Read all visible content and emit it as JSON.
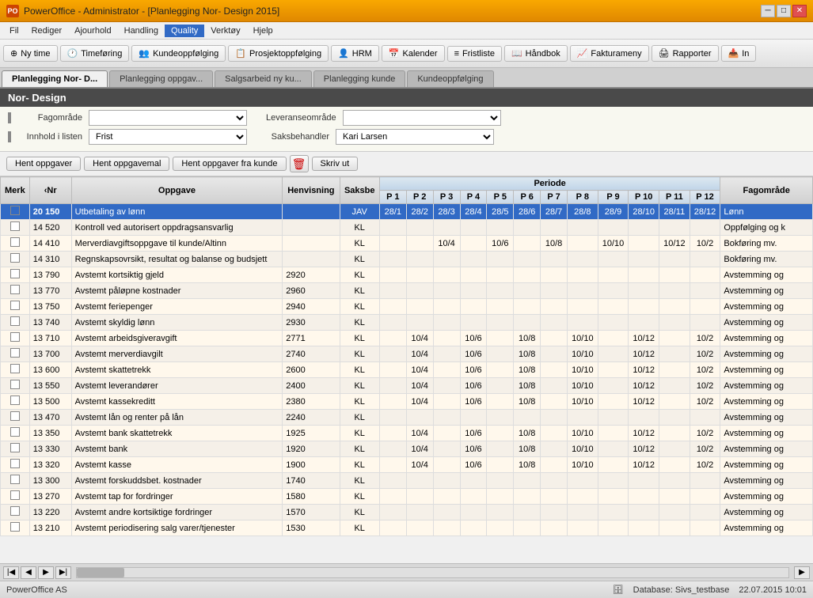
{
  "titlebar": {
    "title": "PowerOffice - Administrator - [Planlegging Nor- Design 2015]",
    "icon": "PO",
    "controls": [
      "minimize",
      "restore",
      "close"
    ]
  },
  "menu": {
    "items": [
      "Fil",
      "Rediger",
      "Ajourhold",
      "Handling",
      "Quality",
      "Verktøy",
      "Hjelp"
    ]
  },
  "toolbar": {
    "items": [
      {
        "label": "Ny time",
        "icon": "⊕"
      },
      {
        "label": "Timeføring",
        "icon": "🕐"
      },
      {
        "label": "Kundeoppfølging",
        "icon": "👥"
      },
      {
        "label": "Prosjektoppfølging",
        "icon": "📋"
      },
      {
        "label": "HRM",
        "icon": "👤"
      },
      {
        "label": "Kalender",
        "icon": "📅"
      },
      {
        "label": "Fristliste",
        "icon": "≡"
      },
      {
        "label": "Håndbok",
        "icon": "📖"
      },
      {
        "label": "Fakturameny",
        "icon": "📈"
      },
      {
        "label": "Rapporter",
        "icon": "🖨"
      },
      {
        "label": "In",
        "icon": "📥"
      }
    ]
  },
  "tabs": [
    {
      "label": "Planlegging Nor- D...",
      "active": true
    },
    {
      "label": "Planlegging oppgav...",
      "active": false
    },
    {
      "label": "Salgsarbeid ny ku...",
      "active": false
    },
    {
      "label": "Planlegging kunde",
      "active": false
    },
    {
      "label": "Kundeoppfølging",
      "active": false
    }
  ],
  "section": {
    "title": "Nor- Design"
  },
  "filters": {
    "fagomrade_label": "Fagområde",
    "fagomrade_value": "",
    "leveranseomrade_label": "Leveranseområde",
    "leveranseomrade_value": "",
    "innhold_label": "Innhold i listen",
    "innhold_value": "Frist",
    "saksbehandler_label": "Saksbehandler",
    "saksbehandler_value": "Kari Larsen"
  },
  "action_buttons": [
    {
      "label": "Hent oppgaver"
    },
    {
      "label": "Hent oppgavemal"
    },
    {
      "label": "Hent oppgaver fra kunde"
    },
    {
      "label": "🗑",
      "type": "delete"
    },
    {
      "label": "Skriv ut"
    }
  ],
  "table": {
    "header_row1": {
      "merk": "Merk",
      "nr": "‹Nr",
      "oppgave": "Oppgave",
      "henvisning": "Henvisning",
      "saksbe": "Saksbe",
      "periode": "Periode",
      "fagomrade": "Fagområde"
    },
    "header_row2": {
      "p1": "P 1",
      "p2": "P 2",
      "p3": "P 3",
      "p4": "P 4",
      "p5": "P 5",
      "p6": "P 6",
      "p7": "P 7",
      "p8": "P 8",
      "p9": "P 9",
      "p10": "P 10",
      "p11": "P 11",
      "p12": "P 12"
    },
    "rows": [
      {
        "checked": true,
        "nr": "20 150",
        "oppgave": "Utbetaling av lønn",
        "henvisning": "",
        "saksbe": "JAV",
        "p1": "28/1",
        "p2": "28/2",
        "p3": "28/3",
        "p4": "28/4",
        "p5": "28/5",
        "p6": "28/6",
        "p7": "28/7",
        "p8": "28/8",
        "p9": "28/9",
        "p10": "28/10",
        "p11": "28/11",
        "p12": "28/12",
        "fagomrade": "Lønn",
        "selected": true
      },
      {
        "checked": false,
        "nr": "14 520",
        "oppgave": "Kontroll ved autorisert oppdragsansvarlig",
        "henvisning": "",
        "saksbe": "KL",
        "p1": "",
        "p2": "",
        "p3": "",
        "p4": "",
        "p5": "",
        "p6": "",
        "p7": "",
        "p8": "",
        "p9": "",
        "p10": "",
        "p11": "",
        "p12": "",
        "fagomrade": "Oppfølging og k",
        "selected": false
      },
      {
        "checked": false,
        "nr": "14 410",
        "oppgave": "Merverdiavgiftsoppgave til kunde/Altinn",
        "henvisning": "",
        "saksbe": "KL",
        "p1": "",
        "p2": "",
        "p3": "10/4",
        "p4": "",
        "p5": "10/6",
        "p6": "",
        "p7": "10/8",
        "p8": "",
        "p9": "10/10",
        "p10": "",
        "p11": "10/12",
        "p12": "10/2",
        "fagomrade": "Bokføring mv.",
        "selected": false
      },
      {
        "checked": false,
        "nr": "14 310",
        "oppgave": "Regnskapsovrsikt, resultat og balanse og budsjett",
        "henvisning": "",
        "saksbe": "KL",
        "p1": "",
        "p2": "",
        "p3": "",
        "p4": "",
        "p5": "",
        "p6": "",
        "p7": "",
        "p8": "",
        "p9": "",
        "p10": "",
        "p11": "",
        "p12": "",
        "fagomrade": "Bokføring mv.",
        "selected": false
      },
      {
        "checked": false,
        "nr": "13 790",
        "oppgave": "Avstemt kortsiktig gjeld",
        "henvisning": "2920",
        "saksbe": "KL",
        "p1": "",
        "p2": "",
        "p3": "",
        "p4": "",
        "p5": "",
        "p6": "",
        "p7": "",
        "p8": "",
        "p9": "",
        "p10": "",
        "p11": "",
        "p12": "",
        "fagomrade": "Avstemming og",
        "selected": false
      },
      {
        "checked": false,
        "nr": "13 770",
        "oppgave": "Avstemt påløpne kostnader",
        "henvisning": "2960",
        "saksbe": "KL",
        "p1": "",
        "p2": "",
        "p3": "",
        "p4": "",
        "p5": "",
        "p6": "",
        "p7": "",
        "p8": "",
        "p9": "",
        "p10": "",
        "p11": "",
        "p12": "",
        "fagomrade": "Avstemming og",
        "selected": false
      },
      {
        "checked": false,
        "nr": "13 750",
        "oppgave": "Avstemt feriepenger",
        "henvisning": "2940",
        "saksbe": "KL",
        "p1": "",
        "p2": "",
        "p3": "",
        "p4": "",
        "p5": "",
        "p6": "",
        "p7": "",
        "p8": "",
        "p9": "",
        "p10": "",
        "p11": "",
        "p12": "",
        "fagomrade": "Avstemming og",
        "selected": false
      },
      {
        "checked": false,
        "nr": "13 740",
        "oppgave": "Avstemt skyldig lønn",
        "henvisning": "2930",
        "saksbe": "KL",
        "p1": "",
        "p2": "",
        "p3": "",
        "p4": "",
        "p5": "",
        "p6": "",
        "p7": "",
        "p8": "",
        "p9": "",
        "p10": "",
        "p11": "",
        "p12": "",
        "fagomrade": "Avstemming og",
        "selected": false
      },
      {
        "checked": false,
        "nr": "13 710",
        "oppgave": "Avstemt arbeidsgiveravgift",
        "henvisning": "2771",
        "saksbe": "KL",
        "p1": "",
        "p2": "10/4",
        "p3": "",
        "p4": "10/6",
        "p5": "",
        "p6": "10/8",
        "p7": "",
        "p8": "10/10",
        "p9": "",
        "p10": "10/12",
        "p11": "",
        "p12": "10/2",
        "fagomrade": "Avstemming og",
        "selected": false
      },
      {
        "checked": false,
        "nr": "13 700",
        "oppgave": "Avstemt merverdiavgilt",
        "henvisning": "2740",
        "saksbe": "KL",
        "p1": "",
        "p2": "10/4",
        "p3": "",
        "p4": "10/6",
        "p5": "",
        "p6": "10/8",
        "p7": "",
        "p8": "10/10",
        "p9": "",
        "p10": "10/12",
        "p11": "",
        "p12": "10/2",
        "fagomrade": "Avstemming og",
        "selected": false
      },
      {
        "checked": false,
        "nr": "13 600",
        "oppgave": "Avstemt skattetrekk",
        "henvisning": "2600",
        "saksbe": "KL",
        "p1": "",
        "p2": "10/4",
        "p3": "",
        "p4": "10/6",
        "p5": "",
        "p6": "10/8",
        "p7": "",
        "p8": "10/10",
        "p9": "",
        "p10": "10/12",
        "p11": "",
        "p12": "10/2",
        "fagomrade": "Avstemming og",
        "selected": false
      },
      {
        "checked": false,
        "nr": "13 550",
        "oppgave": "Avstemt leverandører",
        "henvisning": "2400",
        "saksbe": "KL",
        "p1": "",
        "p2": "10/4",
        "p3": "",
        "p4": "10/6",
        "p5": "",
        "p6": "10/8",
        "p7": "",
        "p8": "10/10",
        "p9": "",
        "p10": "10/12",
        "p11": "",
        "p12": "10/2",
        "fagomrade": "Avstemming og",
        "selected": false
      },
      {
        "checked": false,
        "nr": "13 500",
        "oppgave": "Avstemt kassekreditt",
        "henvisning": "2380",
        "saksbe": "KL",
        "p1": "",
        "p2": "10/4",
        "p3": "",
        "p4": "10/6",
        "p5": "",
        "p6": "10/8",
        "p7": "",
        "p8": "10/10",
        "p9": "",
        "p10": "10/12",
        "p11": "",
        "p12": "10/2",
        "fagomrade": "Avstemming og",
        "selected": false
      },
      {
        "checked": false,
        "nr": "13 470",
        "oppgave": "Avstemt lån og renter på lån",
        "henvisning": "2240",
        "saksbe": "KL",
        "p1": "",
        "p2": "",
        "p3": "",
        "p4": "",
        "p5": "",
        "p6": "",
        "p7": "",
        "p8": "",
        "p9": "",
        "p10": "",
        "p11": "",
        "p12": "",
        "fagomrade": "Avstemming og",
        "selected": false
      },
      {
        "checked": false,
        "nr": "13 350",
        "oppgave": "Avstemt bank skattetrekk",
        "henvisning": "1925",
        "saksbe": "KL",
        "p1": "",
        "p2": "10/4",
        "p3": "",
        "p4": "10/6",
        "p5": "",
        "p6": "10/8",
        "p7": "",
        "p8": "10/10",
        "p9": "",
        "p10": "10/12",
        "p11": "",
        "p12": "10/2",
        "fagomrade": "Avstemming og",
        "selected": false
      },
      {
        "checked": false,
        "nr": "13 330",
        "oppgave": "Avstemt bank",
        "henvisning": "1920",
        "saksbe": "KL",
        "p1": "",
        "p2": "10/4",
        "p3": "",
        "p4": "10/6",
        "p5": "",
        "p6": "10/8",
        "p7": "",
        "p8": "10/10",
        "p9": "",
        "p10": "10/12",
        "p11": "",
        "p12": "10/2",
        "fagomrade": "Avstemming og",
        "selected": false
      },
      {
        "checked": false,
        "nr": "13 320",
        "oppgave": "Avstemt kasse",
        "henvisning": "1900",
        "saksbe": "KL",
        "p1": "",
        "p2": "10/4",
        "p3": "",
        "p4": "10/6",
        "p5": "",
        "p6": "10/8",
        "p7": "",
        "p8": "10/10",
        "p9": "",
        "p10": "10/12",
        "p11": "",
        "p12": "10/2",
        "fagomrade": "Avstemming og",
        "selected": false
      },
      {
        "checked": false,
        "nr": "13 300",
        "oppgave": "Avstemt forskuddsbet. kostnader",
        "henvisning": "1740",
        "saksbe": "KL",
        "p1": "",
        "p2": "",
        "p3": "",
        "p4": "",
        "p5": "",
        "p6": "",
        "p7": "",
        "p8": "",
        "p9": "",
        "p10": "",
        "p11": "",
        "p12": "",
        "fagomrade": "Avstemming og",
        "selected": false
      },
      {
        "checked": false,
        "nr": "13 270",
        "oppgave": "Avstemt tap for fordringer",
        "henvisning": "1580",
        "saksbe": "KL",
        "p1": "",
        "p2": "",
        "p3": "",
        "p4": "",
        "p5": "",
        "p6": "",
        "p7": "",
        "p8": "",
        "p9": "",
        "p10": "",
        "p11": "",
        "p12": "",
        "fagomrade": "Avstemming og",
        "selected": false
      },
      {
        "checked": false,
        "nr": "13 220",
        "oppgave": "Avstemt andre kortsiktige fordringer",
        "henvisning": "1570",
        "saksbe": "KL",
        "p1": "",
        "p2": "",
        "p3": "",
        "p4": "",
        "p5": "",
        "p6": "",
        "p7": "",
        "p8": "",
        "p9": "",
        "p10": "",
        "p11": "",
        "p12": "",
        "fagomrade": "Avstemming og",
        "selected": false
      },
      {
        "checked": false,
        "nr": "13 210",
        "oppgave": "Avstemt periodisering salg varer/tjenester",
        "henvisning": "1530",
        "saksbe": "KL",
        "p1": "",
        "p2": "",
        "p3": "",
        "p4": "",
        "p5": "",
        "p6": "",
        "p7": "",
        "p8": "",
        "p9": "",
        "p10": "",
        "p11": "",
        "p12": "",
        "fagomrade": "Avstemming og",
        "selected": false
      }
    ]
  },
  "statusbar": {
    "company": "PowerOffice AS",
    "database_icon": "🗄",
    "database": "Database: Sivs_testbase",
    "date": "22.07.2015 10:01"
  }
}
